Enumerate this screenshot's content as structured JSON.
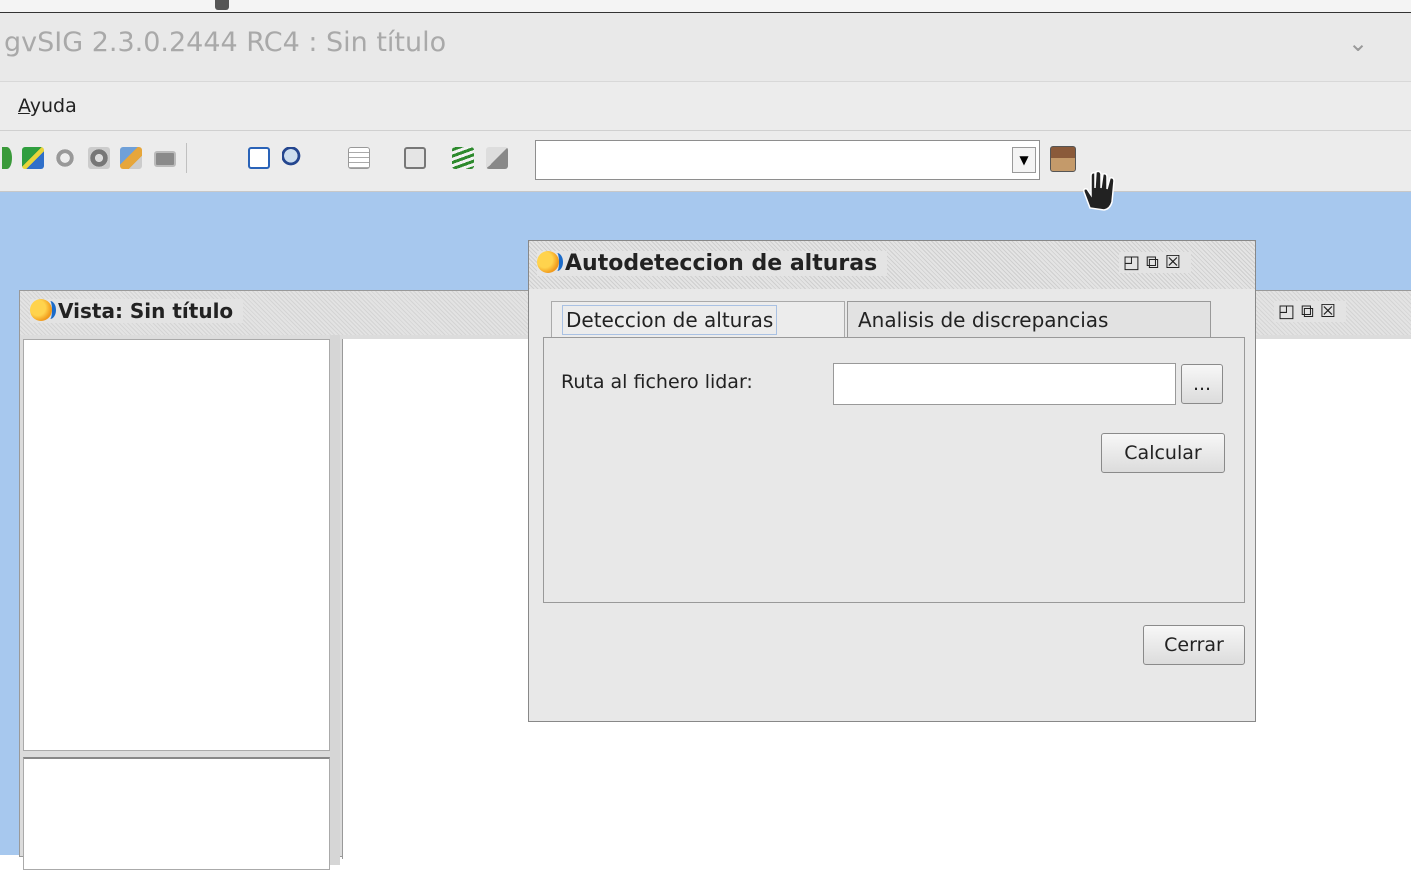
{
  "window": {
    "title": "gvSIG 2.3.0.2444 RC4 : Sin título"
  },
  "menubar": {
    "items": [
      {
        "underline": "A",
        "rest": "yuda"
      }
    ]
  },
  "toolbar": {
    "icons": [
      "globe-icon",
      "map-icon",
      "link-icon",
      "photo-icon",
      "edit-icon",
      "screen-icon",
      "doc-icon",
      "zoom-icon",
      "table-icon",
      "clipboard-icon",
      "layers-icon",
      "layer-edit-icon",
      "add-layer-icon"
    ],
    "combo_value": ""
  },
  "vista": {
    "title": "Vista: Sin título",
    "buttons": "◰⧉☒"
  },
  "dialog": {
    "title": "Autodeteccion de alturas",
    "buttons": "◰⧉☒",
    "tabs": [
      "Deteccion de alturas",
      "Analisis de discrepancias"
    ],
    "path_label": "Ruta al fichero lidar:",
    "path_value": "",
    "browse_label": "...",
    "calculate_label": "Calcular",
    "close_label": "Cerrar"
  },
  "colors": {
    "desktop": "#a7c8ee",
    "accent_orange": "#f19a1b",
    "accent_blue": "#1b6bc9"
  }
}
